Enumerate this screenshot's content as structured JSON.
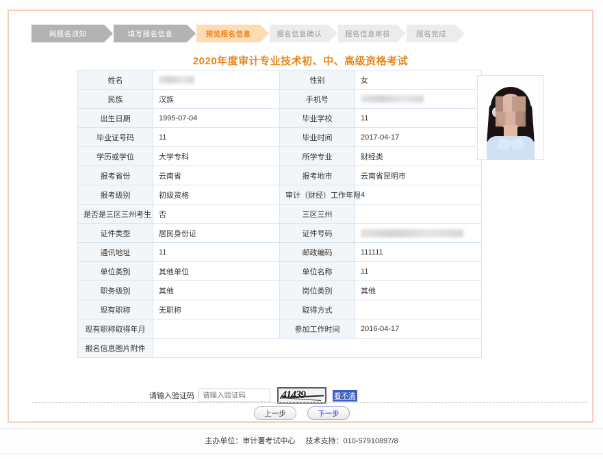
{
  "steps": [
    {
      "label": "网报名须知",
      "state": "done"
    },
    {
      "label": "填写报名信息",
      "state": "done"
    },
    {
      "label": "预览报名信息",
      "state": "active"
    },
    {
      "label": "报名信息确认",
      "state": "todo"
    },
    {
      "label": "报名信息审核",
      "state": "todo"
    },
    {
      "label": "报名完成",
      "state": "todo"
    }
  ],
  "form": {
    "title": "2020年度审计专业技术初、中、高级资格考试",
    "rows": [
      {
        "label1": "姓名",
        "value1": "",
        "blur1": "name",
        "label2": "性别",
        "value2": "女"
      },
      {
        "label1": "民族",
        "value1": "汉族",
        "label2": "手机号",
        "value2": "",
        "blur2": "phone"
      },
      {
        "label1": "出生日期",
        "value1": "1995-07-04",
        "label2": "毕业学校",
        "value2": "11"
      },
      {
        "label1": "毕业证号码",
        "value1": "11",
        "label2": "毕业时间",
        "value2": "2017-04-17"
      },
      {
        "label1": "学历或学位",
        "value1": "大学专科",
        "label2": "所学专业",
        "value2": "财经类"
      },
      {
        "label1": "报考省份",
        "value1": "云南省",
        "label2": "报考地市",
        "value2": "云南省昆明市"
      },
      {
        "label1": "报考级别",
        "value1": "初级资格",
        "label2": "审计（财经）工作年限",
        "value2": "4"
      },
      {
        "label1": "是否是三区三州考生",
        "value1": "否",
        "label2": "三区三州",
        "value2": ""
      },
      {
        "label1": "证件类型",
        "value1": "居民身份证",
        "label2": "证件号码",
        "value2": "",
        "blur2": "idno"
      },
      {
        "label1": "通讯地址",
        "value1": "11",
        "label2": "邮政编码",
        "value2": "111111"
      },
      {
        "label1": "单位类别",
        "value1": "其他单位",
        "label2": "单位名称",
        "value2": "11"
      },
      {
        "label1": "职务级别",
        "value1": "其他",
        "label2": "岗位类别",
        "value2": "其他"
      },
      {
        "label1": "现有职称",
        "value1": "无职称",
        "label2": "取得方式",
        "value2": ""
      },
      {
        "label1": "现有职称取得年月",
        "value1": "",
        "label2": "参加工作时间",
        "value2": "2016-04-17"
      }
    ],
    "attachment_label": "报名信息图片附件",
    "attachment_value": ""
  },
  "photo": {
    "alt": "applicant-photo"
  },
  "captcha": {
    "label": "请输入验证码",
    "placeholder": "请输入验证码",
    "input_value": "",
    "code_text": "41439",
    "refresh_link": "看不清"
  },
  "buttons": {
    "prev": "上一步",
    "next": "下一步"
  },
  "footer": {
    "organizer": "主办单位：审计署考试中心",
    "support": "技术支持：010-57910897/8"
  },
  "colors": {
    "accent_orange": "#ef8420",
    "title_orange": "#e8861a",
    "border_pink": "#f6cdbb",
    "label_bg": "#f3f6f9",
    "cell_border": "#d6e4f0",
    "link_blue": "#3b5fc0"
  }
}
